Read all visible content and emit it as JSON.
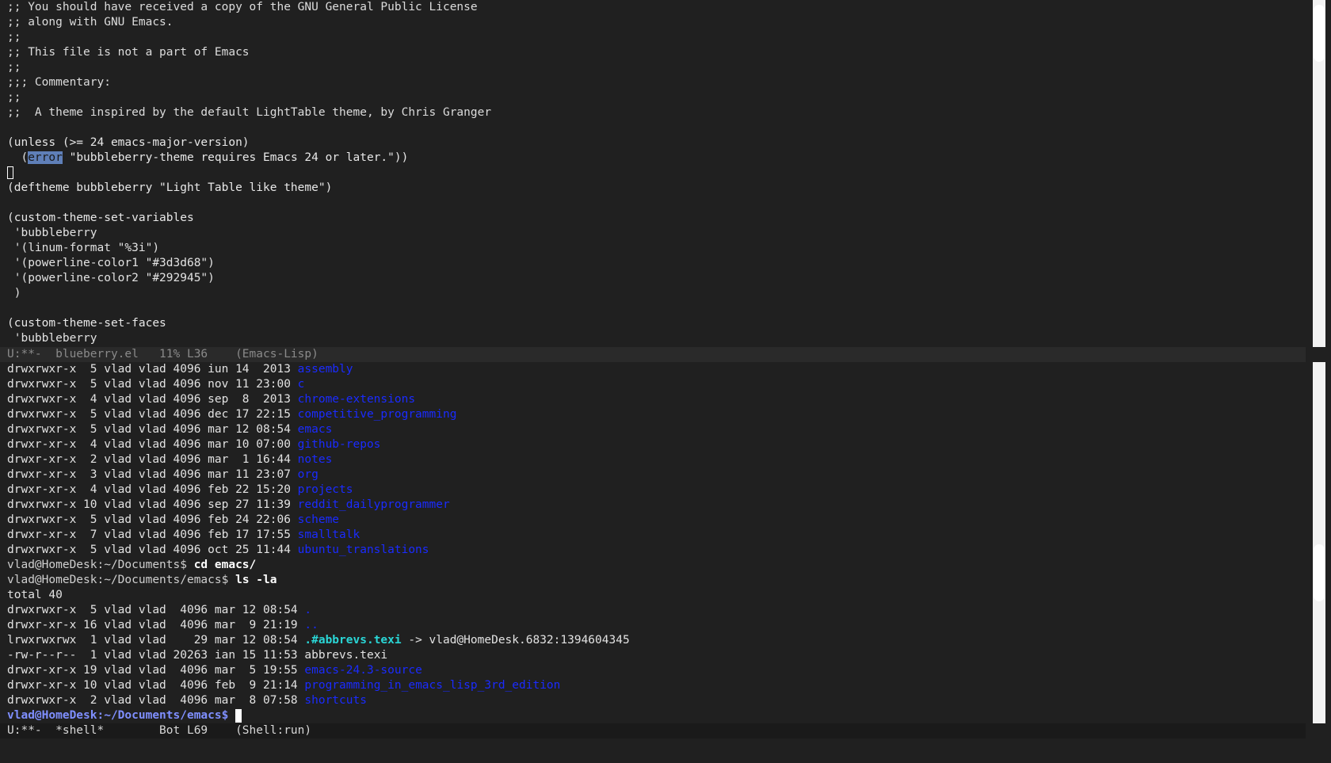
{
  "editor": {
    "lines": [
      ";; You should have received a copy of the GNU General Public License",
      ";; along with GNU Emacs.",
      ";;",
      ";; This file is not a part of Emacs",
      ";;",
      ";;; Commentary:",
      ";;",
      ";;  A theme inspired by the default LightTable theme, by Chris Granger",
      "",
      "(unless (>= 24 emacs-major-version)",
      "",
      "",
      "(deftheme bubbleberry \"Light Table like theme\")",
      "",
      "(custom-theme-set-variables",
      " 'bubbleberry",
      " '(linum-format \"%3i\")",
      " '(powerline-color1 \"#3d3d68\")",
      " '(powerline-color2 \"#292945\")",
      " )",
      "",
      "(custom-theme-set-faces",
      " 'bubbleberry"
    ],
    "error_line_prefix": "  (",
    "error_selected": "error",
    "error_line_suffix": " \"bubbleberry-theme requires Emacs 24 or later.\"))"
  },
  "modeline_top": "U:**-  blueberry.el   11% L36    (Emacs-Lisp)",
  "shell": {
    "listing1": [
      {
        "perms": "drwxrwxr-x  5 vlad vlad 4096 iun 14  2013 ",
        "name": "assembly"
      },
      {
        "perms": "drwxrwxr-x  5 vlad vlad 4096 nov 11 23:00 ",
        "name": "c"
      },
      {
        "perms": "drwxrwxr-x  4 vlad vlad 4096 sep  8  2013 ",
        "name": "chrome-extensions"
      },
      {
        "perms": "drwxrwxr-x  5 vlad vlad 4096 dec 17 22:15 ",
        "name": "competitive_programming"
      },
      {
        "perms": "drwxrwxr-x  5 vlad vlad 4096 mar 12 08:54 ",
        "name": "emacs"
      },
      {
        "perms": "drwxr-xr-x  4 vlad vlad 4096 mar 10 07:00 ",
        "name": "github-repos"
      },
      {
        "perms": "drwxr-xr-x  2 vlad vlad 4096 mar  1 16:44 ",
        "name": "notes"
      },
      {
        "perms": "drwxr-xr-x  3 vlad vlad 4096 mar 11 23:07 ",
        "name": "org"
      },
      {
        "perms": "drwxr-xr-x  4 vlad vlad 4096 feb 22 15:20 ",
        "name": "projects"
      },
      {
        "perms": "drwxrwxr-x 10 vlad vlad 4096 sep 27 11:39 ",
        "name": "reddit_dailyprogrammer"
      },
      {
        "perms": "drwxrwxr-x  5 vlad vlad 4096 feb 24 22:06 ",
        "name": "scheme"
      },
      {
        "perms": "drwxr-xr-x  7 vlad vlad 4096 feb 17 17:55 ",
        "name": "smalltalk"
      },
      {
        "perms": "drwxrwxr-x  5 vlad vlad 4096 oct 25 11:44 ",
        "name": "ubuntu_translations"
      }
    ],
    "prompt1": "vlad@HomeDesk:~/Documents$ ",
    "cmd1": "cd emacs/",
    "prompt2": "vlad@HomeDesk:~/Documents/emacs$ ",
    "cmd2": "ls -la",
    "total": "total 40",
    "listing2": [
      {
        "perms": "drwxrwxr-x  5 vlad vlad  4096 mar 12 08:54 ",
        "name": ".",
        "kind": "dir"
      },
      {
        "perms": "drwxr-xr-x 16 vlad vlad  4096 mar  9 21:19 ",
        "name": "..",
        "kind": "dir"
      },
      {
        "perms": "lrwxrwxrwx  1 vlad vlad    29 mar 12 08:54 ",
        "name": ".#abbrevs.texi",
        "kind": "link",
        "target": " -> vlad@HomeDesk.6832:1394604345"
      },
      {
        "perms": "-rw-r--r--  1 vlad vlad 20263 ian 15 11:53 ",
        "name": "abbrevs.texi",
        "kind": "file"
      },
      {
        "perms": "drwxr-xr-x 19 vlad vlad  4096 mar  5 19:55 ",
        "name": "emacs-24.3-source",
        "kind": "dir"
      },
      {
        "perms": "drwxr-xr-x 10 vlad vlad  4096 feb  9 21:14 ",
        "name": "programming_in_emacs_lisp_3rd_edition",
        "kind": "dir"
      },
      {
        "perms": "drwxrwxr-x  2 vlad vlad  4096 mar  8 07:58 ",
        "name": "shortcuts",
        "kind": "dir"
      }
    ],
    "final_prompt": "vlad@HomeDesk:~/Documents/emacs$ "
  },
  "modeline_bottom": "U:**-  *shell*        Bot L69    (Shell:run)",
  "colors": {
    "background": "#202020",
    "directory": "#1a2bff",
    "symlink": "#2ad6d6",
    "selection": "#5f7fb8"
  }
}
